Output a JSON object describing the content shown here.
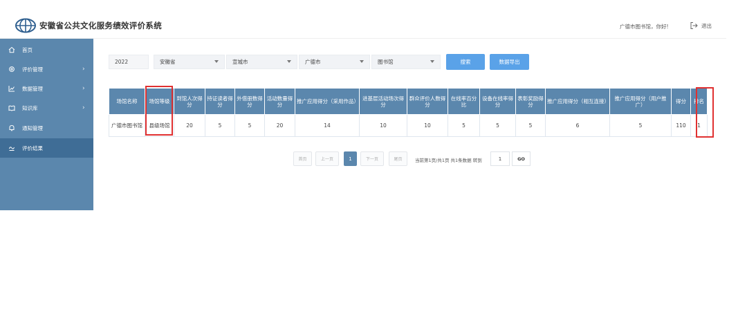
{
  "header": {
    "title": "安徽省公共文化服务绩效评价系统",
    "greeting": "广德市图书馆，你好!",
    "logout_label": "退出"
  },
  "sidebar": {
    "items": [
      {
        "label": "首页",
        "icon": "home-icon",
        "has_arrow": false,
        "active": false
      },
      {
        "label": "评价管理",
        "icon": "settings-icon",
        "has_arrow": true,
        "active": false
      },
      {
        "label": "数据管理",
        "icon": "chart-icon",
        "has_arrow": true,
        "active": false
      },
      {
        "label": "知识库",
        "icon": "book-icon",
        "has_arrow": true,
        "active": false
      },
      {
        "label": "通知管理",
        "icon": "bell-icon",
        "has_arrow": false,
        "active": false
      },
      {
        "label": "评价结果",
        "icon": "result-icon",
        "has_arrow": false,
        "active": true
      }
    ]
  },
  "filters": {
    "year": "2022",
    "province": "安徽省",
    "city": "宣城市",
    "county": "广德市",
    "venue_type": "图书馆",
    "search_label": "搜索",
    "export_label": "数据导出"
  },
  "table": {
    "headers": [
      "场馆名称",
      "场馆等级",
      "到馆人次得分",
      "持证读者得分",
      "外借册数得分",
      "活动数量得分",
      "推广应用得分（采用作品）",
      "进基层活动场次得分",
      "群众评价人数得分",
      "在线率百分比",
      "设备在线率得分",
      "表彰奖励得分",
      "推广应用得分（相互连接）",
      "推广应用得分（用户推广）",
      "得分",
      "排名"
    ],
    "rows": [
      [
        "广德市图书馆",
        "县级场馆",
        "20",
        "5",
        "5",
        "20",
        "14",
        "10",
        "10",
        "5",
        "5",
        "5",
        "6",
        "5",
        "110",
        "1"
      ]
    ]
  },
  "pagination": {
    "first": "首页",
    "prev": "上一页",
    "current": "1",
    "next": "下一页",
    "last": "尾页",
    "info": "当前第1页/共1页 共1条数据 转到",
    "jump_value": "1",
    "go": "GO"
  },
  "colors": {
    "accent": "#5b87ad",
    "sidebar_active": "#3f6d96",
    "button": "#5aa2e8",
    "highlight": "#e03030"
  }
}
